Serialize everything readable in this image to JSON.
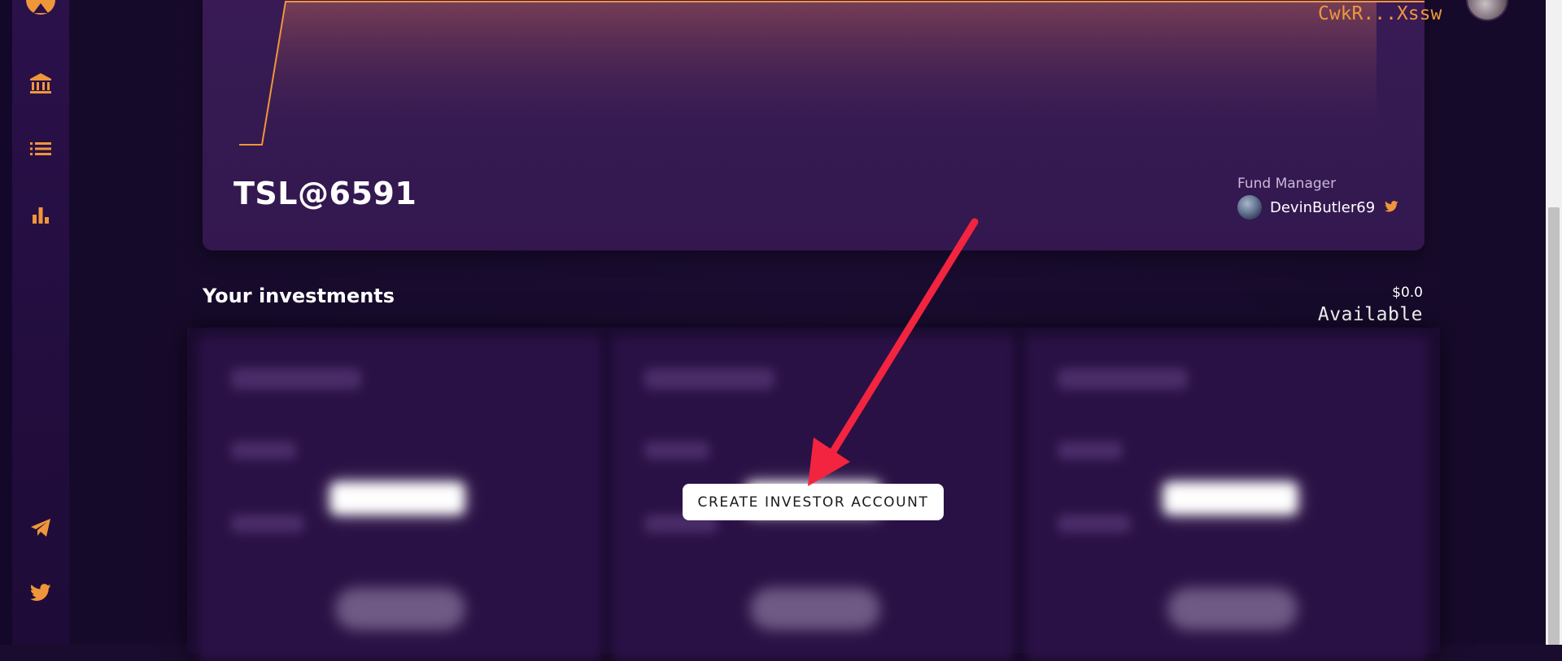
{
  "sidebar": {
    "items": [
      {
        "icon": "bank-icon"
      },
      {
        "icon": "list-icon"
      },
      {
        "icon": "bar-chart-icon"
      },
      {
        "icon": "telegram-icon"
      },
      {
        "icon": "twitter-icon"
      }
    ],
    "accent_color": "#f0963a"
  },
  "header": {
    "wallet_address": "CwkR...Xssw"
  },
  "fund": {
    "name": "TSL@6591",
    "manager_caption": "Fund Manager",
    "manager_name": "DevinButler69"
  },
  "investments": {
    "heading": "Your investments",
    "balance": "$0.0",
    "balance_label": "Available",
    "cta_label": "CREATE INVESTOR ACCOUNT"
  },
  "colors": {
    "background": "#1a0c2e",
    "card": "#351a52",
    "accent": "#f0963a",
    "annotation_arrow": "#f2243f"
  }
}
